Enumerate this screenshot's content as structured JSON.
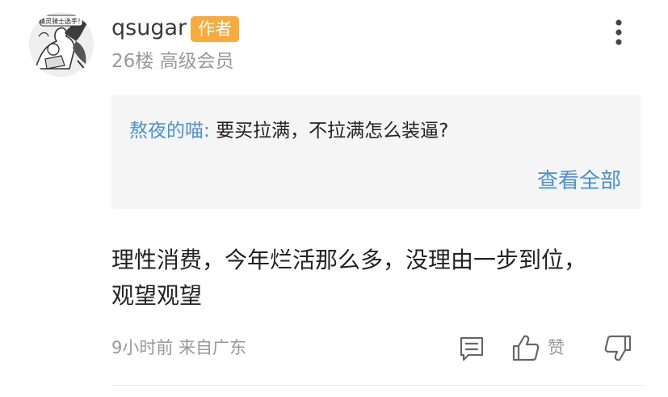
{
  "comment": {
    "username": "qsugar",
    "author_badge": "作者",
    "floor": "26楼",
    "member_level": "高级会员",
    "avatar_caption": "精灵骑士选手！",
    "quote": {
      "author": "熬夜的喵:",
      "text": "要买拉满，不拉满怎么装逼?",
      "view_all_label": "查看全部"
    },
    "content_lines": [
      "理性消费，今年烂活那么多，没理由一步到位，",
      "观望观望"
    ],
    "time_location": "9小时前 来自广东",
    "like_label": "赞"
  },
  "icons": {
    "more": "more-vertical-icon",
    "reply": "reply-comment-icon",
    "like": "thumbs-up-icon",
    "dislike": "thumbs-down-icon"
  },
  "colors": {
    "badge": "#f6ab3c",
    "link": "#4a90d9",
    "muted": "#999999",
    "quote_bg": "#f5f5f5"
  }
}
